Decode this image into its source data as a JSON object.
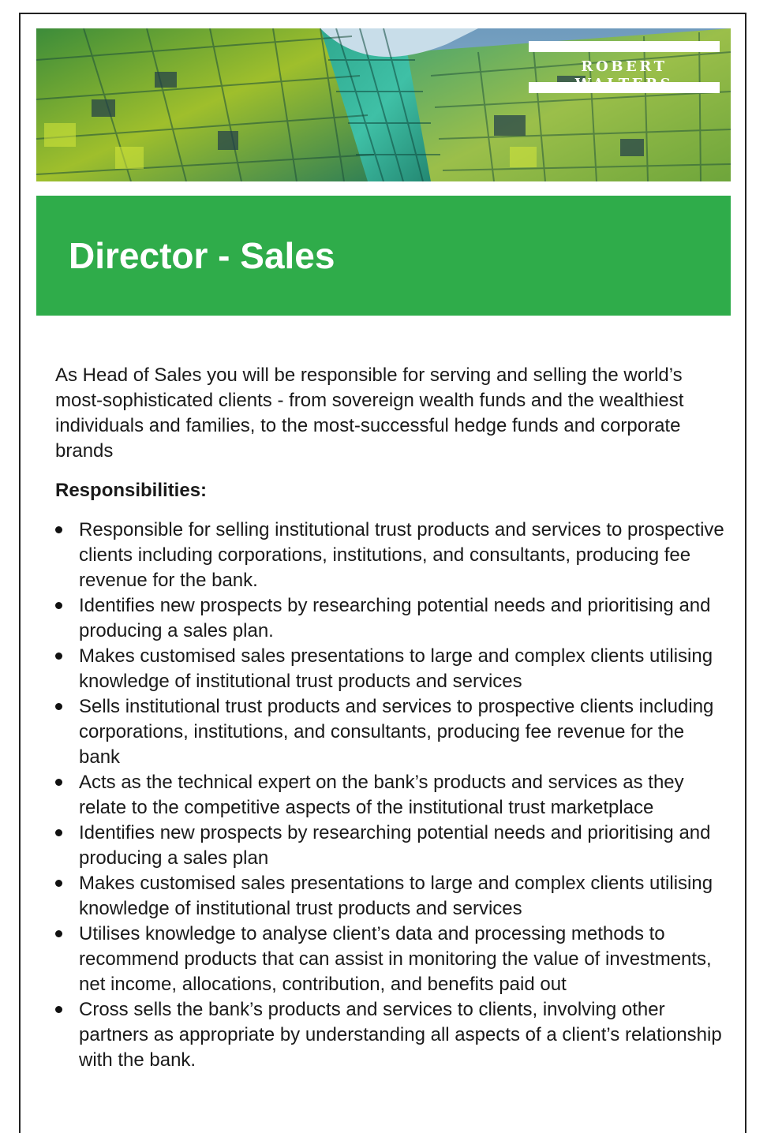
{
  "brand": {
    "logo_text": "ROBERT WALTERS"
  },
  "job": {
    "title": "Director - Sales",
    "intro": "As Head of Sales you will be responsible for serving and selling the world’s most-sophisticated clients - from sovereign wealth funds and the wealthiest individuals and families, to the most-successful hedge funds and corporate brands",
    "responsibilities_heading": "Responsibilities:",
    "responsibilities": [
      "Responsible for selling institutional trust products and services to prospective clients including corporations, institutions, and consultants, producing fee revenue for the bank.",
      "Identifies new prospects by researching potential needs and prioritising and producing a sales plan.",
      "Makes customised sales presentations to large and complex clients utilising knowledge of institutional trust products and services",
      "Sells institutional trust products and services to prospective clients including corporations, institutions, and consultants, producing fee revenue for the bank",
      "Acts as the technical expert on the bank’s products and services as they relate to the competitive aspects of the institutional trust marketplace",
      "Identifies new prospects by researching potential needs and prioritising and producing a sales plan",
      "Makes customised sales presentations to large and complex clients utilising knowledge of institutional trust products and services",
      "Utilises knowledge to analyse client’s data and processing methods to recommend products that can assist in monitoring the value of investments, net income, allocations, contribution, and benefits paid out",
      "Cross sells the bank’s products and services to clients, involving other partners as appropriate by understanding all aspects of a client’s relationship with the bank."
    ]
  },
  "colors": {
    "title_block": "#2fac4a",
    "frame_border": "#222222",
    "body_text": "#1a1a1a"
  }
}
